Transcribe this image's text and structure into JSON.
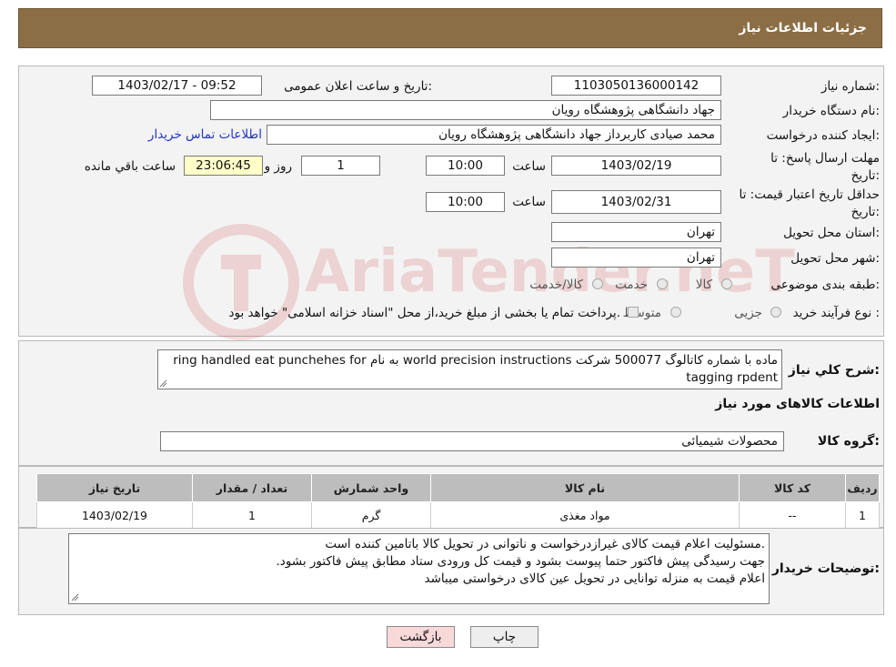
{
  "header": {
    "title": "جزئیات اطلاعات نیاز"
  },
  "fields": {
    "need_number_label": "شماره نیاز:",
    "need_number": "1103050136000142",
    "announce_label": "تاریخ و ساعت اعلان عمومی:",
    "announce_value": "1403/02/17 - 09:52",
    "buyer_org_label": "نام دستگاه خریدار:",
    "buyer_org": "جهاد دانشگاهی پژوهشگاه رویان",
    "creator_label": "ایجاد کننده درخواست:",
    "creator": "محمد صیادی کاربرداز جهاد دانشگاهی پژوهشگاه رویان",
    "contact_link": "اطلاعات تماس خریدار",
    "reply_deadline_label": "مهلت ارسال پاسخ: تا تاریخ:",
    "reply_date": "1403/02/19",
    "time_label": "ساعت",
    "reply_time": "10:00",
    "days_value": "1",
    "days_label": "روز و",
    "remaining_time": "23:06:45",
    "remaining_label": "ساعت باقي مانده",
    "price_validity_label": "حداقل تاریخ اعتبار قیمت: تا تاریخ:",
    "price_validity_date": "1403/02/31",
    "price_validity_time": "10:00",
    "province_label": "استان محل تحویل:",
    "province": "تهران",
    "city_label": "شهر محل تحویل:",
    "city": "تهران",
    "category_label": "طبقه بندی موضوعی:",
    "category_options": [
      "کالا",
      "خدمت",
      "کالا/خدمت"
    ],
    "process_label": "نوع فرآیند خرید :",
    "process_options": [
      "جزیی",
      "متوسط"
    ],
    "process_note": "پرداخت تمام یا بخشی از مبلغ خرید،از محل \"اسناد خزانه اسلامی\" خواهد بود."
  },
  "description": {
    "label": "شرح کلي نياز:",
    "line1": "ماده با شماره کاتالوگ  500077 شرکت world precision instructions به نام ring handled eat punchehes for",
    "line2": "tagging rpdent"
  },
  "goods_section": {
    "title": "اطلاعات کالاهای مورد نیاز",
    "group_label": "گروه کالا:",
    "group_value": "محصولات شیمیائی"
  },
  "table": {
    "headers": [
      "ردیف",
      "کد کالا",
      "نام کالا",
      "واحد شمارش",
      "تعداد / مقدار",
      "تاریخ نیاز"
    ],
    "rows": [
      [
        "1",
        "--",
        "مواد مغذی",
        "گرم",
        "1",
        "1403/02/19"
      ]
    ]
  },
  "buyer_notes": {
    "label": "توضیحات خریدار:",
    "lines": [
      ".مسئولیت اعلام قیمت کالای غیرازدرخواست و ناتوانی در تحویل کالا باتامین کننده است",
      "جهت رسیدگی پیش فاکتور حتما پیوست بشود و قیمت کل ورودی ستاد مطابق پیش فاکتور بشود.",
      "اعلام قیمت به منزله توانایی در تحویل عین کالای درخواستی میباشد"
    ]
  },
  "buttons": {
    "print": "چاپ",
    "back": "بازگشت"
  },
  "watermark": {
    "text": "AriaTender.neT"
  },
  "colors": {
    "header_bg": "#8c6e46",
    "link": "#2233cc",
    "back_button_bg": "#f8d9d9",
    "timer_bg": "#ffffc8"
  }
}
